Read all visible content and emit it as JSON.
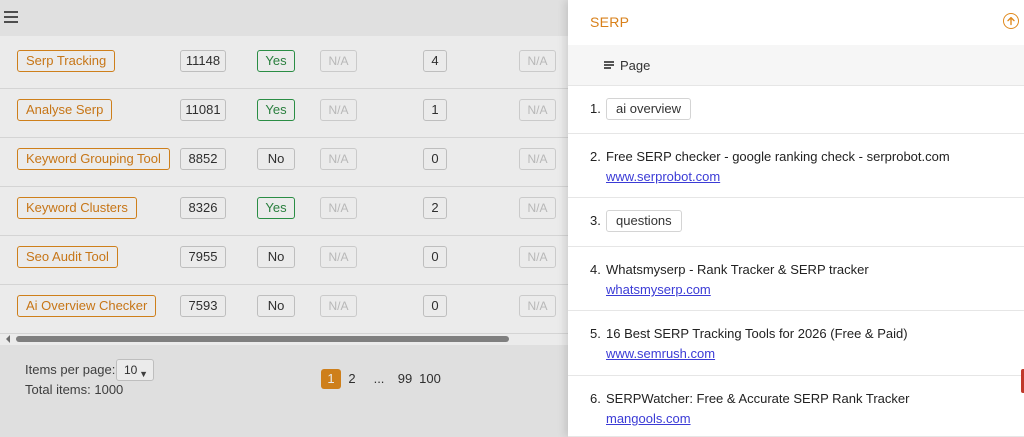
{
  "table": {
    "rows": [
      {
        "keyword": "Serp Tracking",
        "volume": "11148",
        "flag": "Yes",
        "na1": "N/A",
        "count": "4",
        "na2": "N/A"
      },
      {
        "keyword": "Analyse Serp",
        "volume": "11081",
        "flag": "Yes",
        "na1": "N/A",
        "count": "1",
        "na2": "N/A"
      },
      {
        "keyword": "Keyword Grouping Tool",
        "volume": "8852",
        "flag": "No",
        "na1": "N/A",
        "count": "0",
        "na2": "N/A"
      },
      {
        "keyword": "Keyword Clusters",
        "volume": "8326",
        "flag": "Yes",
        "na1": "N/A",
        "count": "2",
        "na2": "N/A"
      },
      {
        "keyword": "Seo Audit Tool",
        "volume": "7955",
        "flag": "No",
        "na1": "N/A",
        "count": "0",
        "na2": "N/A"
      },
      {
        "keyword": "Ai Overview Checker",
        "volume": "7593",
        "flag": "No",
        "na1": "N/A",
        "count": "0",
        "na2": "N/A"
      }
    ]
  },
  "footer": {
    "items_per_page_label": "Items per page:",
    "items_per_page_value": "10",
    "total_items": "Total items: 1000",
    "pages": [
      "1",
      "2",
      "...",
      "99",
      "100"
    ],
    "active_page": "1"
  },
  "drawer": {
    "title": "SERP",
    "header_label": "Page",
    "results": [
      {
        "num": "1.",
        "type": "tag",
        "text": "ai overview"
      },
      {
        "num": "2.",
        "type": "link",
        "title": "Free SERP checker - google ranking check - serprobot.com",
        "url": "www.serprobot.com"
      },
      {
        "num": "3.",
        "type": "tag",
        "text": "questions"
      },
      {
        "num": "4.",
        "type": "link",
        "title": "Whatsmyserp - Rank Tracker & SERP tracker",
        "url": "whatsmyserp.com"
      },
      {
        "num": "5.",
        "type": "link",
        "title": "16 Best SERP Tracking Tools for 2026 (Free & Paid)",
        "url": "www.semrush.com"
      },
      {
        "num": "6.",
        "type": "link",
        "title": "SERPWatcher: Free & Accurate SERP Rank Tracker",
        "url": "mangools.com"
      }
    ]
  },
  "colors": {
    "accent": "#e08a1e",
    "yes_green": "#2e9a4a",
    "link_blue": "#3b3bd6"
  },
  "icons": {
    "menu": "hamburger-menu-icon",
    "collapse": "arrow-up-circle-icon",
    "page_header": "lines-icon"
  }
}
